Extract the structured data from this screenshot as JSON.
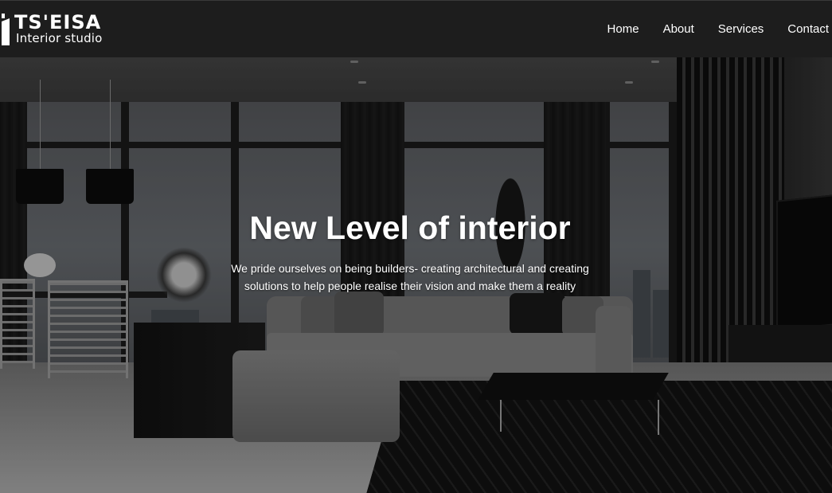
{
  "brand": {
    "name": "TS'EISA",
    "tagline": "Interior studio",
    "icon": "logo-mark-icon"
  },
  "nav": {
    "items": [
      {
        "label": "Home"
      },
      {
        "label": "About"
      },
      {
        "label": "Services"
      },
      {
        "label": "Contact"
      }
    ]
  },
  "hero": {
    "title": "New Level of interior",
    "subtitle": "We pride ourselves on being builders- creating architectural and creating solutions to help people realise their vision and make them a reality",
    "background_image": "dark living room interior with sectional sofa and city-view windows"
  },
  "colors": {
    "navbar_bg": "#1d1d1d",
    "text": "#ffffff"
  }
}
